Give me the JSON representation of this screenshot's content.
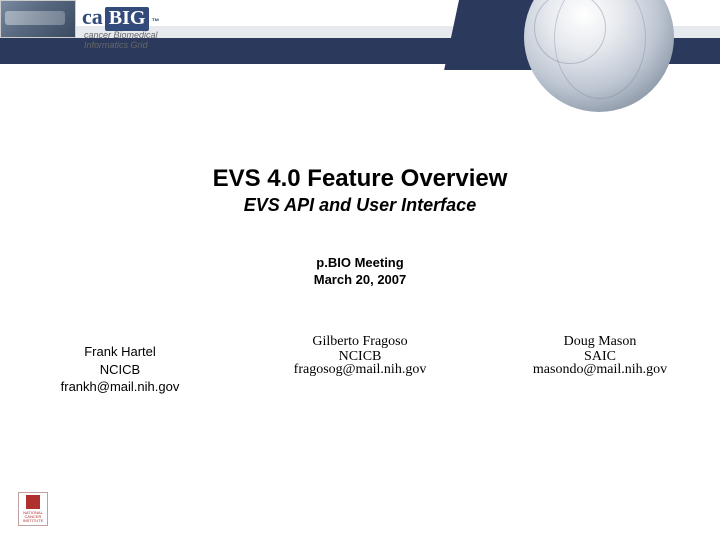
{
  "banner": {
    "logo_prefix": "ca",
    "logo_main": "BIG",
    "logo_tm": "™",
    "logo_sub_line1": "cancer Biomedical",
    "logo_sub_line2": "Informatics Grid"
  },
  "title": {
    "main": "EVS 4.0 Feature Overview",
    "sub": "EVS API and User Interface"
  },
  "meeting": {
    "name": "p.BIO Meeting",
    "date": "March 20, 2007"
  },
  "authors": [
    {
      "name": "Frank Hartel",
      "org": "NCICB",
      "email": "frankh@mail.nih.gov"
    },
    {
      "name": "Gilberto Fragoso",
      "org": "NCICB",
      "email": "fragosog@mail.nih.gov"
    },
    {
      "name": "Doug Mason",
      "org": "SAIC",
      "email": "masondo@mail.nih.gov"
    }
  ],
  "footer": {
    "org": "NATIONAL CANCER INSTITUTE"
  }
}
